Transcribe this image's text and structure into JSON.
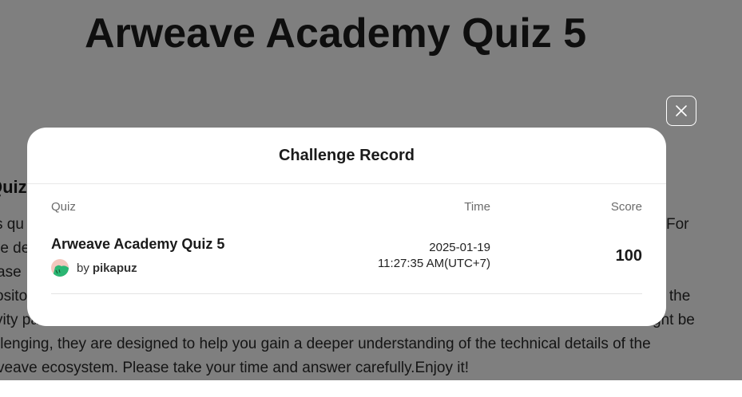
{
  "page": {
    "title": "Arweave Academy Quiz 5",
    "section_heading": "Quiz D",
    "description_lines": [
      {
        "left": "s qu",
        "right": "For"
      },
      {
        "left": "re de"
      },
      {
        "left": "ase"
      },
      {
        "left": "osito",
        "right": "n the"
      },
      {
        "left": "vity pa",
        "right": "ght be"
      },
      {
        "full": "llenging, they are designed to help you gain a deeper understanding of the technical details of the"
      },
      {
        "full": "veave ecosystem. Please take your time and answer carefully.Enjoy it!"
      }
    ]
  },
  "modal": {
    "title": "Challenge Record",
    "columns": {
      "quiz": "Quiz",
      "time": "Time",
      "score": "Score"
    },
    "records": [
      {
        "quiz_name": "Arweave Academy Quiz 5",
        "by_label": "by",
        "author": "pikapuz",
        "date": "2025-01-19",
        "time": "11:27:35 AM(UTC+7)",
        "score": "100"
      }
    ],
    "close_icon": "close-icon"
  },
  "colors": {
    "overlay": "#000000",
    "avatar_bg": "#f3c7bd",
    "avatar_accent": "#2bb673"
  }
}
